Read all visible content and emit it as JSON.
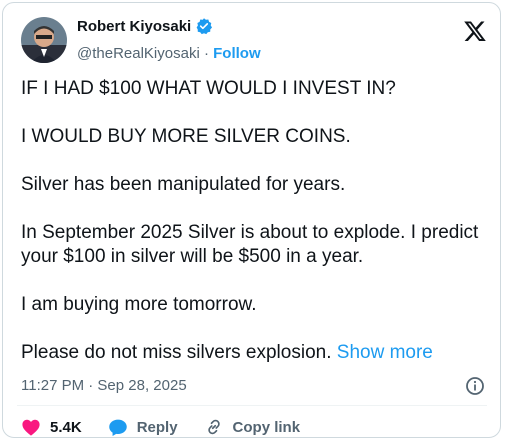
{
  "author": {
    "display_name": "Robert Kiyosaki",
    "handle": "@theRealKiyosaki",
    "separator": "·",
    "follow_label": "Follow",
    "verified": true
  },
  "post": {
    "paragraphs": [
      "IF I HAD $100 WHAT WOULD I INVEST IN?",
      "I WOULD BUY MORE SILVER COINS.",
      "Silver has been manipulated for years.",
      "In September 2025 Silver is about to explode.  I predict your $100 in silver will be $500 in a year.",
      "I am buying more tomorrow.",
      "Please do not miss silvers explosion."
    ],
    "show_more_label": "Show more",
    "timestamp": "11:27 PM · Sep 28, 2025"
  },
  "actions": {
    "likes": "5.4K",
    "reply_label": "Reply",
    "copy_link_label": "Copy link"
  },
  "colors": {
    "accent": "#1d9bf0",
    "like": "#f91880",
    "muted": "#536471"
  },
  "icons": [
    "x-logo-icon",
    "verified-badge-icon",
    "info-icon",
    "heart-icon",
    "reply-icon",
    "link-icon"
  ]
}
